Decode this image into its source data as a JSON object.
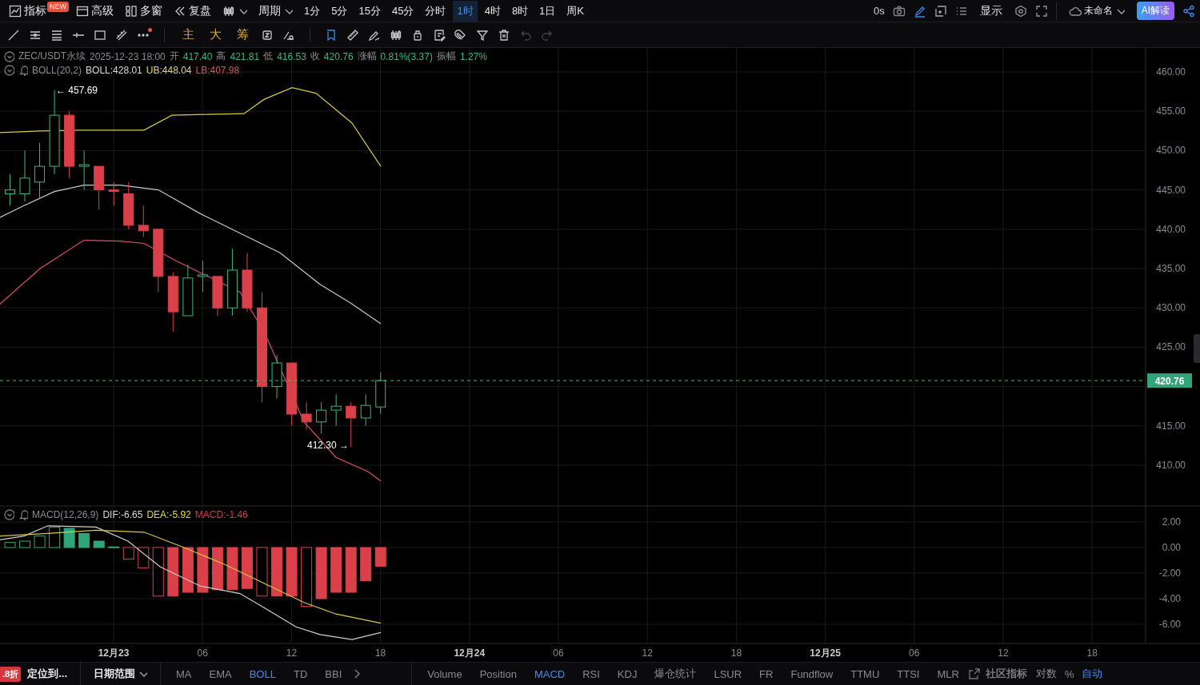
{
  "top_bar": {
    "menu": [
      {
        "label": "指标",
        "badge": "NEW"
      },
      {
        "label": "高级"
      },
      {
        "label": "多窗"
      },
      {
        "label": "复盘"
      }
    ],
    "period_menu": "周期",
    "intervals": [
      {
        "label": "1分",
        "selected": false
      },
      {
        "label": "5分",
        "selected": false
      },
      {
        "label": "15分",
        "selected": false
      },
      {
        "label": "45分",
        "selected": false
      },
      {
        "label": "分时",
        "selected": false
      },
      {
        "label": "1时",
        "selected": true
      },
      {
        "label": "4时",
        "selected": false
      },
      {
        "label": "8时",
        "selected": false
      },
      {
        "label": "1日",
        "selected": false
      },
      {
        "label": "周K",
        "selected": false
      }
    ],
    "timer": "0s",
    "display": "显示",
    "layout_name": "未命名",
    "ai_button": "AI解读"
  },
  "toolbar": {
    "chip_tools": [
      "主",
      "大",
      "筹"
    ]
  },
  "legend": {
    "symbol": "ZEC/USDT永续",
    "time": "2025-12-23 18:00",
    "fields": [
      {
        "label": "开",
        "value": "417.40"
      },
      {
        "label": "高",
        "value": "421.81"
      },
      {
        "label": "低",
        "value": "416.53"
      },
      {
        "label": "收",
        "value": "420.76"
      },
      {
        "label": "涨幅",
        "value": "0.81%(3.37)"
      },
      {
        "label": "振幅",
        "value": "1.27%"
      }
    ]
  },
  "boll": {
    "name": "BOLL(20,2)",
    "values": [
      {
        "text": "BOLL:428.01",
        "color": "#d8d8d8"
      },
      {
        "text": "UB:448.04",
        "color": "#e6d84a"
      },
      {
        "text": "LB:407.98",
        "color": "#d9506a"
      }
    ]
  },
  "price_chart": {
    "y_ticks_upper": [
      "460.00",
      "455.00",
      "450.00",
      "445.00",
      "440.00",
      "435.00",
      "430.00",
      "425.00"
    ],
    "y_ticks_lower": [
      "415.00",
      "410.00"
    ],
    "last_price": "420.76",
    "high_marker": "← 457.69",
    "low_marker": "412.30 →"
  },
  "macd": {
    "name": "MACD(12,26,9)",
    "values": [
      {
        "text": "DIF:-6.65",
        "color": "#d8d8d8"
      },
      {
        "text": "DEA:-5.92",
        "color": "#e6d84a"
      },
      {
        "text": "MACD:-1.46",
        "color": "#c8404a"
      }
    ],
    "y_ticks": [
      "2.00",
      "0.00",
      "-2.00",
      "-4.00",
      "-6.00"
    ]
  },
  "time_axis": [
    {
      "label": "12月23",
      "kind": "date"
    },
    {
      "label": "06",
      "kind": "hour"
    },
    {
      "label": "12",
      "kind": "hour"
    },
    {
      "label": "18",
      "kind": "hour"
    },
    {
      "label": "12月24",
      "kind": "date"
    },
    {
      "label": "06",
      "kind": "hour"
    },
    {
      "label": "12",
      "kind": "hour"
    },
    {
      "label": "18",
      "kind": "hour"
    },
    {
      "label": "12月25",
      "kind": "date"
    },
    {
      "label": "06",
      "kind": "hour"
    },
    {
      "label": "12",
      "kind": "hour"
    },
    {
      "label": "18",
      "kind": "hour"
    }
  ],
  "bottom_bar": {
    "promo_badge": ".8折",
    "locate": "定位到...",
    "date_range": "日期范围",
    "main_indicators": [
      {
        "label": "MA",
        "selected": false
      },
      {
        "label": "EMA",
        "selected": false
      },
      {
        "label": "BOLL",
        "selected": true
      },
      {
        "label": "TD",
        "selected": false
      },
      {
        "label": "BBI",
        "selected": false
      }
    ],
    "sub_indicators": [
      {
        "label": "Volume",
        "selected": false
      },
      {
        "label": "Position",
        "selected": false
      },
      {
        "label": "MACD",
        "selected": true
      },
      {
        "label": "RSI",
        "selected": false
      },
      {
        "label": "KDJ",
        "selected": false
      },
      {
        "label": "爆仓统计",
        "selected": false
      },
      {
        "label": "LSUR",
        "selected": false
      },
      {
        "label": "FR",
        "selected": false
      },
      {
        "label": "Fundflow",
        "selected": false
      },
      {
        "label": "TTMU",
        "selected": false
      },
      {
        "label": "TTSI",
        "selected": false
      },
      {
        "label": "MLR",
        "selected": false
      }
    ],
    "community": "社区指标",
    "scale_options": [
      {
        "label": "对数",
        "selected": false
      },
      {
        "label": "%",
        "selected": false
      },
      {
        "label": "自动",
        "selected": true
      }
    ]
  }
}
